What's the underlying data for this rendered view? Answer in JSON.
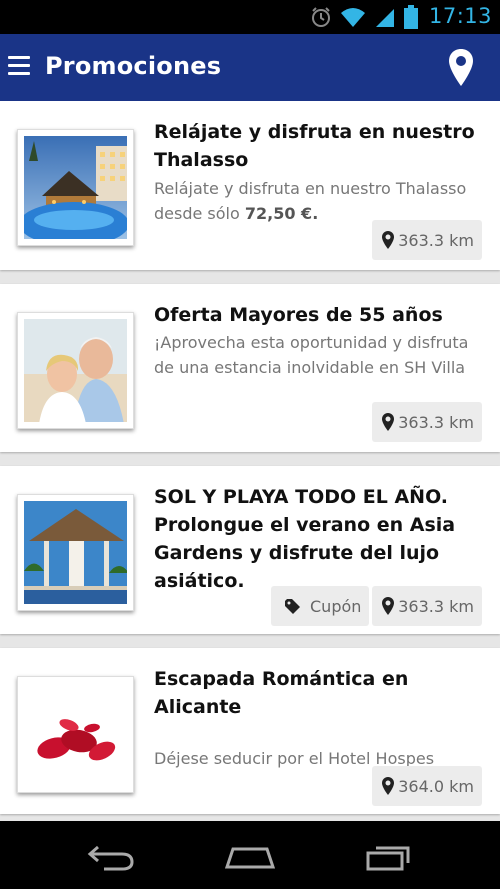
{
  "status_bar": {
    "time": "17:13",
    "icons": [
      "alarm-icon",
      "wifi-icon",
      "signal-icon",
      "battery-icon"
    ]
  },
  "app_bar": {
    "title": "Promociones",
    "icons": [
      "hamburger-menu-icon",
      "location-pin-icon"
    ]
  },
  "theme": {
    "primary": "#1a3487",
    "status_time": "#33b5e5",
    "card_bg": "#ffffff",
    "list_bg": "#e6e6e6"
  },
  "promotions": [
    {
      "title": "Relájate y disfruta en nuestro Thalasso",
      "desc_text": "Relájate y disfruta en nuestro Thalasso desde sólo ",
      "desc_price": "72,50 €.",
      "distance": "363.3 km",
      "image": "hotel-pool-night"
    },
    {
      "title": "Oferta Mayores de 55 años",
      "desc_text": "¡Aprovecha esta oportunidad y disfruta de una estancia inolvidable en SH Villa",
      "distance": "363.3 km",
      "image": "senior-couple"
    },
    {
      "title": "SOL Y PLAYA TODO EL AÑO. Prolongue el verano en Asia Gardens y disfrute del lujo asiático.",
      "coupon": "Cupón",
      "distance": "363.3 km",
      "image": "asian-pavilion"
    },
    {
      "title": "Escapada Romántica en Alicante",
      "desc_text": "Déjese seducir por el Hotel Hospes",
      "distance": "364.0 km",
      "image": "rose-petals"
    }
  ],
  "nav_bar": {
    "icons": [
      "back-icon",
      "home-icon",
      "recent-apps-icon"
    ]
  }
}
